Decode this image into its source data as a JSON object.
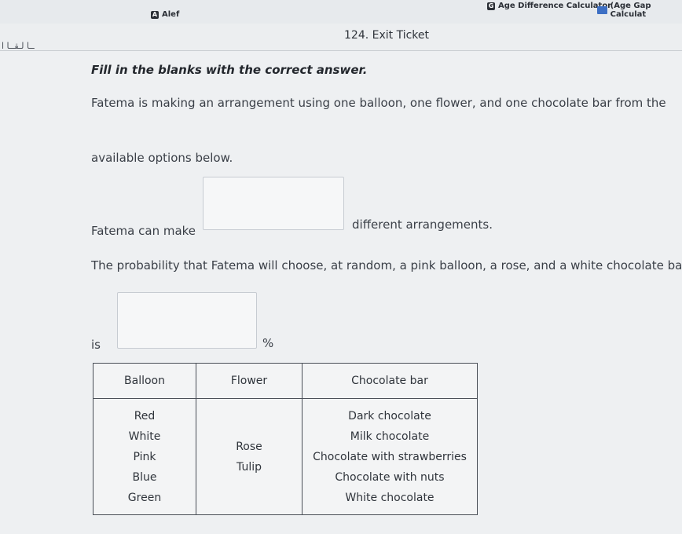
{
  "tabs": [
    {
      "icon": "A",
      "label": "Alef"
    },
    {
      "icon": "G",
      "label": "Age Difference Calculator"
    },
    {
      "icon": "",
      "label": "(Age Gap Calculat"
    }
  ],
  "header": {
    "logo": "ــا لـقــا ا",
    "ticket_title": "124. Exit Ticket"
  },
  "question": {
    "instruction": "Fill in the blanks with the correct answer.",
    "line1": "Fatema is making an arrangement using one balloon, one flower, and one chocolate bar from the",
    "line2": "available options below.",
    "line3_prefix": "Fatema can make",
    "line3_suffix": "different arrangements.",
    "line4": "The probability that Fatema will choose, at random, a pink balloon, a rose, and a white chocolate bar",
    "line5_prefix": "is",
    "line5_suffix": "%"
  },
  "answers": {
    "arrangements": "",
    "probability": ""
  },
  "table": {
    "headers": [
      "Balloon",
      "Flower",
      "Chocolate bar"
    ],
    "balloons": [
      "Red",
      "White",
      "Pink",
      "Blue",
      "Green"
    ],
    "flowers": [
      "Rose",
      "Tulip"
    ],
    "chocolates": [
      "Dark chocolate",
      "Milk chocolate",
      "Chocolate with strawberries",
      "Chocolate with nuts",
      "White chocolate"
    ]
  }
}
